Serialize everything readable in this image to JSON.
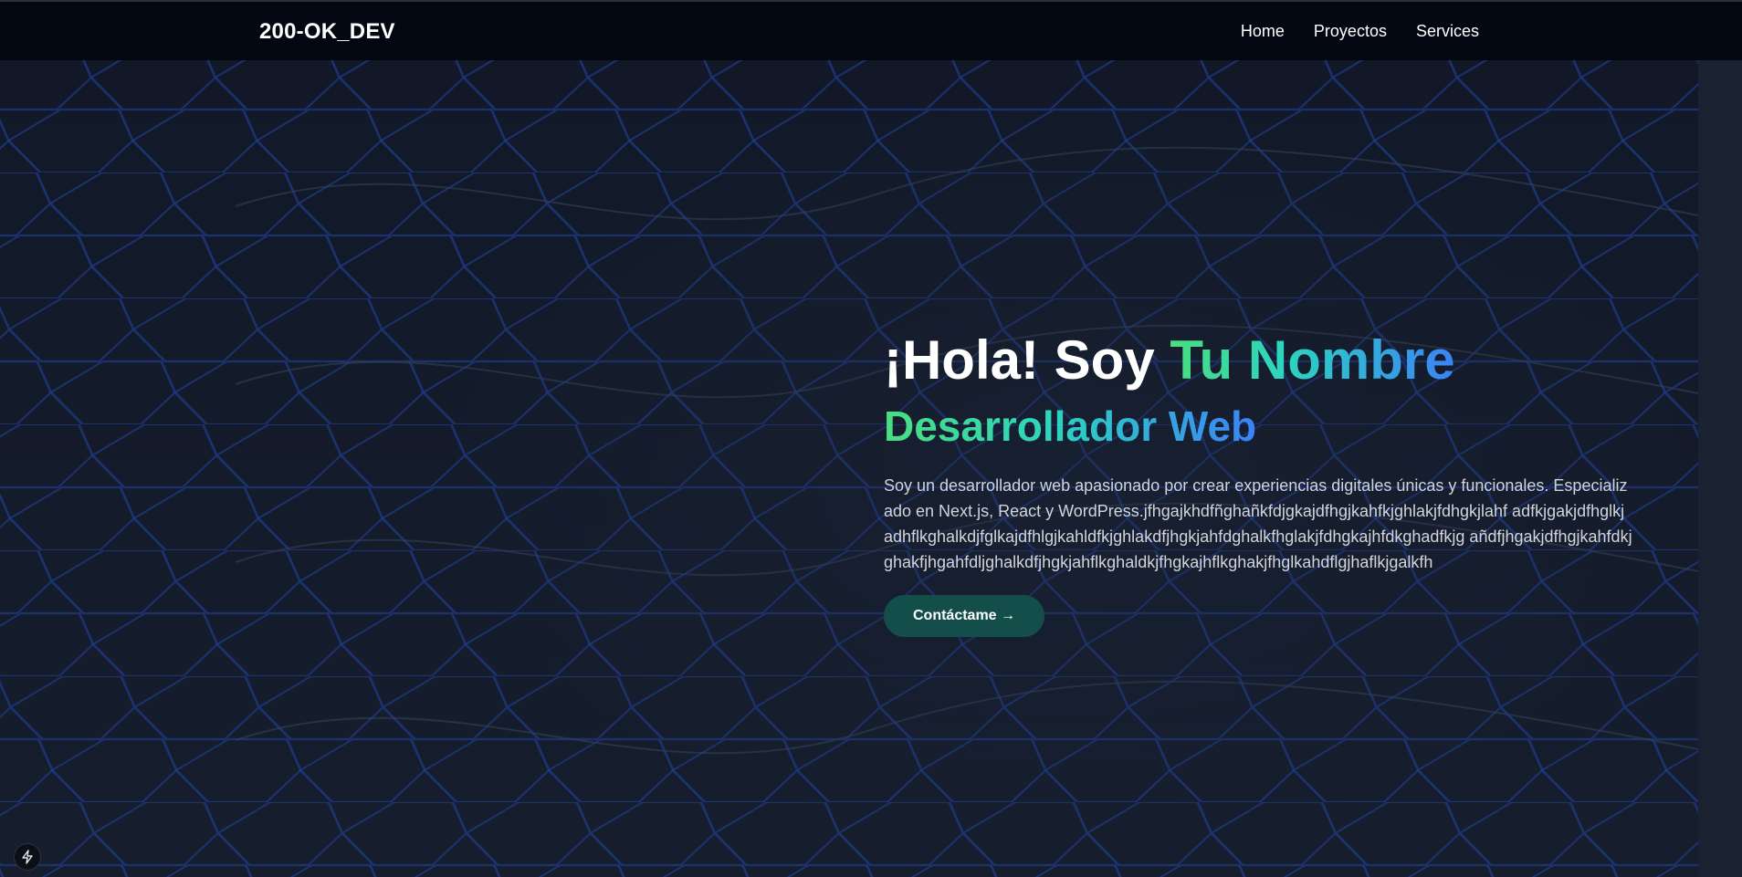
{
  "navbar": {
    "brand": "200-OK_DEV",
    "links": [
      "Home",
      "Proyectos",
      "Services"
    ]
  },
  "hero": {
    "greeting": "¡Hola! Soy ",
    "name": "Tu Nombre",
    "subtitle": "Desarrollador Web",
    "description": "Soy un desarrollador web apasionado por crear experiencias digitales únicas y funcionales. Especializado en Next.js, React y WordPress.jfhgajkhdfñghañkfdjgkajdfhgjkahfkjghlakjfdhgkjlahf adfkjgakjdfhglkjadhflkghalkdjfglkajdfhlgjkahldfkjghlakdfjhgkjahfdghalkfhglakjfdhgkajhfdkghadfkjg añdfjhgakjdfhgjkahfdkjghakfjhgahfdljghalkdfjhgkjahflkghaldkjfhgkajhflkghakjfhglkahdflgjhaflkjgalkfh",
    "cta_label": "Contáctame →"
  },
  "colors": {
    "nav_bg": "#030712",
    "page_bg": "#131a29",
    "accent_green": "#4ade80",
    "accent_blue": "#3b82f6",
    "cta_bg": "#134e4a",
    "pattern_line": "#1e3a8a"
  },
  "icons": {
    "corner_badge": "lightning-bolt-icon"
  }
}
